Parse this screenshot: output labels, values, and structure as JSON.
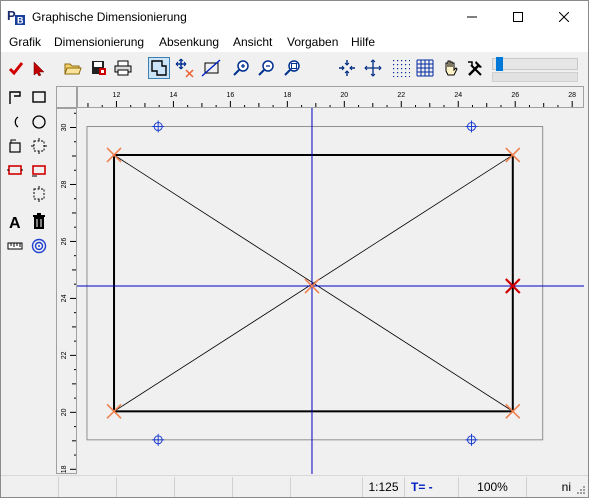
{
  "window": {
    "title": "Graphische Dimensionierung"
  },
  "menu": [
    "Grafik",
    "Dimensionierung",
    "Absenkung",
    "Ansicht",
    "Vorgaben",
    "Hilfe"
  ],
  "toolbar": {
    "icons": [
      "checkmark-icon",
      "pointer-icon",
      "open-folder-icon",
      "save-icon",
      "print-icon",
      "frame-tool-icon",
      "move-node-icon",
      "line-tool-icon",
      "zoom-in-icon",
      "zoom-out-icon",
      "zoom-fit-icon",
      "snap-icon",
      "pan-icon",
      "grid-dots-icon",
      "grid-lines-icon",
      "hand-icon",
      "tools-icon"
    ],
    "zoom_slider_value": 0.05
  },
  "palette": {
    "icons": [
      "corner-tool-icon",
      "rectangle-tool-icon",
      "arc-tool-icon",
      "circle-tool-icon",
      "rotate-tool-icon",
      "selection-tool-icon",
      "red-rect-tool-icon",
      "red-rect-dashed-tool-icon",
      "dashed-rect-tool-icon",
      "text-tool-icon",
      "trash-icon",
      "ruler-icon",
      "target-icon"
    ]
  },
  "ruler": {
    "x_ticks": [
      "12",
      "14",
      "16",
      "18",
      "20",
      "22",
      "24",
      "26",
      "28"
    ],
    "y_ticks": [
      "30",
      "28",
      "26",
      "24",
      "22",
      "20",
      "18"
    ]
  },
  "drawing": {
    "x_range": [
      10.65,
      28.45
    ],
    "y_range": [
      17.8,
      30.65
    ],
    "rectangle": {
      "x1": 11.95,
      "y1": 20.0,
      "x2": 25.95,
      "y2": 29.0
    },
    "outer_frame": {
      "x1": 11.0,
      "y1": 19.0,
      "x2": 27.0,
      "y2": 30.0
    },
    "crosshair": {
      "x": 18.9,
      "y": 24.4
    },
    "orange_markers": [
      [
        11.95,
        29.0
      ],
      [
        25.95,
        29.0
      ],
      [
        11.95,
        20.0
      ],
      [
        25.95,
        20.0
      ],
      [
        18.9,
        24.4
      ]
    ],
    "blue_markers": [
      [
        13.5,
        30.0
      ],
      [
        24.5,
        30.0
      ],
      [
        13.5,
        19.0
      ],
      [
        24.5,
        19.0
      ]
    ],
    "red_marker": [
      25.95,
      24.4
    ],
    "colors": {
      "rectangle": "#000000",
      "diagonals": "#000000",
      "crosshair": "#0000c0",
      "orange_marker": "#f08050",
      "blue_marker": "#2040d0",
      "red_marker": "#d00000",
      "frame": "#909090"
    }
  },
  "status": {
    "scale": "1:125",
    "t_label": "T= -",
    "zoom": "100%",
    "mode": "ni"
  }
}
